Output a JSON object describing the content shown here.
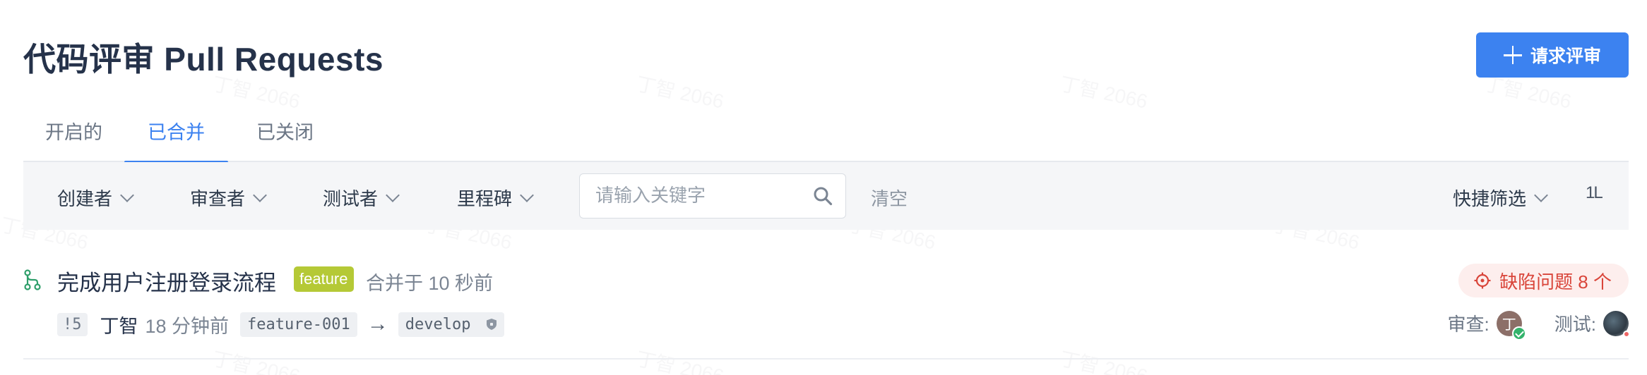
{
  "watermark": "丁智 2066",
  "header": {
    "title": "代码评审 Pull Requests",
    "request_review_label": "请求评审"
  },
  "tabs": [
    {
      "label": "开启的",
      "active": false
    },
    {
      "label": "已合并",
      "active": true
    },
    {
      "label": "已关闭",
      "active": false
    }
  ],
  "filters": {
    "creator": "创建者",
    "reviewer": "审查者",
    "tester": "测试者",
    "milestone": "里程碑",
    "search_placeholder": "请输入关键字",
    "clear": "清空",
    "quick_filter": "快捷筛选",
    "sort_icon": "sort-icon",
    "sort_glyph": "1L"
  },
  "pull_requests": [
    {
      "title": "完成用户注册登录流程",
      "label": "feature",
      "label_color": "#b5c936",
      "merged_time": "合并于 10 秒前",
      "defects": "缺陷问题 8 个",
      "number": "!5",
      "author": "丁智",
      "created": "18 分钟前",
      "source_branch": "feature-001",
      "arrow": "→",
      "target_branch": "develop",
      "review_label": "审查:",
      "reviewer_initial": "丁",
      "test_label": "测试:"
    }
  ],
  "colors": {
    "accent": "#3c82f0",
    "danger": "#d9453a",
    "success": "#33b36b"
  }
}
